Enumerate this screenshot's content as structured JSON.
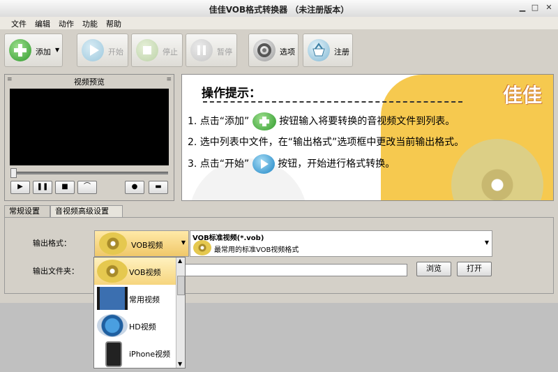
{
  "window": {
    "title": "佳佳VOB格式转换器  （未注册版本）"
  },
  "menu": [
    "文件",
    "编辑",
    "动作",
    "功能",
    "帮助"
  ],
  "toolbar": {
    "add": "添加",
    "start": "开始",
    "stop": "停止",
    "pause": "暂停",
    "options": "选项",
    "register": "注册"
  },
  "preview": {
    "title": "视频预览"
  },
  "tips": {
    "heading": "操作提示：",
    "line1a": "1. 点击“添加”",
    "line1b": "按钮输入将要转换的音视频文件到列表。",
    "line2": "2. 选中列表中文件，在“输出格式”选项框中更改当前输出格式。",
    "line3a": "3. 点击“开始”",
    "line3b": "按钮，开始进行格式转换。",
    "brand": "佳佳"
  },
  "tabs": [
    "常规设置",
    "音视频高级设置"
  ],
  "settings": {
    "format_label": "输出格式：",
    "folder_label": "输出文件夹：",
    "format_selected": "VOB视频",
    "desc_title": "VOB标准视频(*.vob)",
    "desc_text": "最常用的标准VOB视频格式",
    "browse": "浏览",
    "open": "打开"
  },
  "dropdown": [
    "VOB视频",
    "常用视频",
    "HD视频",
    "iPhone视频"
  ],
  "colors": {
    "accent_yellow": "#f6c94f",
    "select_bg": "#f6d57e",
    "video_bg": "#000000"
  }
}
